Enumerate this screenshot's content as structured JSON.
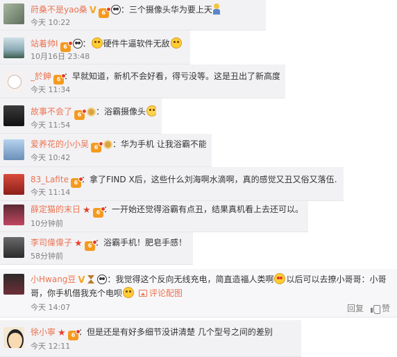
{
  "comments": [
    {
      "username": "莳桑不是yao桑",
      "text": "三个摄像头华为要上天",
      "time": "今天 10:22"
    },
    {
      "username": "站着帅I",
      "text": "硬件牛逼软件无敌",
      "time": "10月16日 23:48"
    },
    {
      "username": "_於鉮",
      "text": "早就知道，新机不会好看，得亏没等。这是丑出了新高度啊",
      "time": "今天 11:34"
    },
    {
      "username": "故事不会了",
      "text": "浴霸摄像头",
      "time": "今天 11:54"
    },
    {
      "username": "爱养花的小小吴",
      "text": "华为手机 让我浴霸不能",
      "time": "今天 10:42"
    },
    {
      "username": "83_Lafite",
      "text": "拿了FIND X后，这些什么刘海啊水滴啊，真的感觉又丑又俗又落伍……",
      "time": "今天 11:14"
    },
    {
      "username": "薛定猫的末日",
      "text": "一开始还觉得浴霸有点丑，结果真机看上去还可以。",
      "time": "10分钟前"
    },
    {
      "username": "李司偉偉子",
      "text": "浴霸手机！肥皂手感！",
      "time": "58分钟前"
    },
    {
      "username": "小Hwang豆",
      "text": "我觉得这个反向无线充电，简直造福人类啊",
      "text_b": "以后可以去撩小哥哥：小哥",
      "text_c": "哥，你手机借我充个电呗",
      "pic_label": "评论配图",
      "time": "今天 14:07",
      "reply": "回复",
      "like": "赞"
    },
    {
      "username": "徐小寧",
      "text": "但是还是有好多细节没讲清楚 几个型号之间的差别",
      "time": "今天 12:11"
    }
  ],
  "separator": "：",
  "icons": {
    "verified": "verified-v-icon",
    "vip": "vip-crown-icon",
    "panda": "panda-icon",
    "star": "star-icon",
    "emoji": "laughing-emoji-icon"
  },
  "colors": {
    "username": "#eb7350",
    "background": "#f2f2f5",
    "meta": "#808080"
  }
}
